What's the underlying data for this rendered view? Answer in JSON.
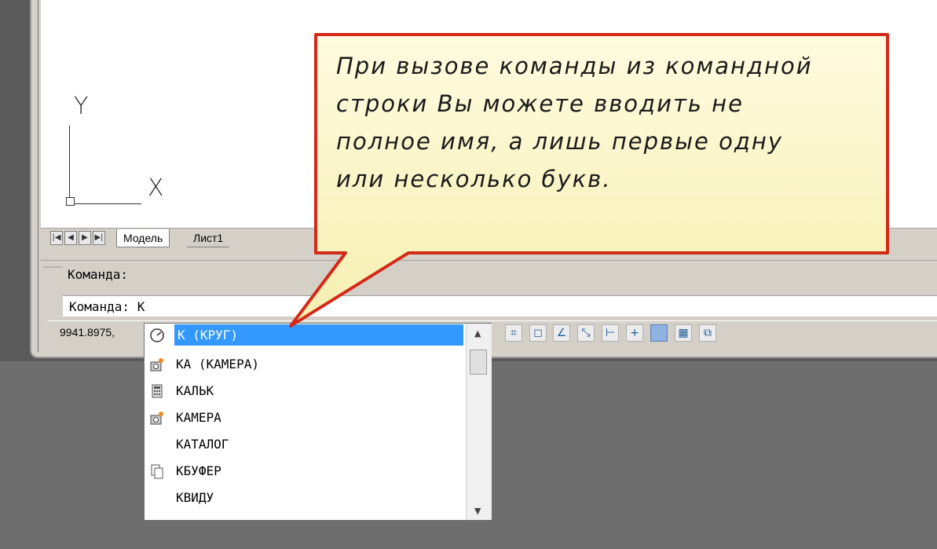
{
  "ucs": {
    "y_label": "Y",
    "x_label": "X"
  },
  "tabs": [
    {
      "label": "Модель",
      "active": true
    },
    {
      "label": "Лист1",
      "active": false
    }
  ],
  "nav_buttons": [
    "|◀",
    "◀",
    "▶",
    "▶|"
  ],
  "command": {
    "history_line": "Команда:",
    "input_line": "Команда: К"
  },
  "status": {
    "coords": "9941.8975,"
  },
  "autocomplete": {
    "items": [
      {
        "label": "К (КРУГ)",
        "icon": "circle-icon",
        "selected": true
      },
      {
        "label": "КА (КАМЕРА)",
        "icon": "camera-icon",
        "selected": false
      },
      {
        "label": "КАЛЬК",
        "icon": "calculator-icon",
        "selected": false
      },
      {
        "label": "КАМЕРА",
        "icon": "camera-icon",
        "selected": false
      },
      {
        "label": "КАТАЛОГ",
        "icon": "",
        "selected": false
      },
      {
        "label": "КБУФЕР",
        "icon": "copy-icon",
        "selected": false
      },
      {
        "label": "КВИДУ",
        "icon": "",
        "selected": false
      }
    ]
  },
  "callout": {
    "text": "При вызове команды из командной\nстроки Вы можете вводить не\nполное имя, а лишь первые одну\nили несколько букв.",
    "fill_color": "#fcf7c0",
    "border_color": "#d32a1a"
  },
  "colors": {
    "selection": "#3399ff",
    "canvas": "#ffffff",
    "chrome": "#d4d0c8"
  }
}
